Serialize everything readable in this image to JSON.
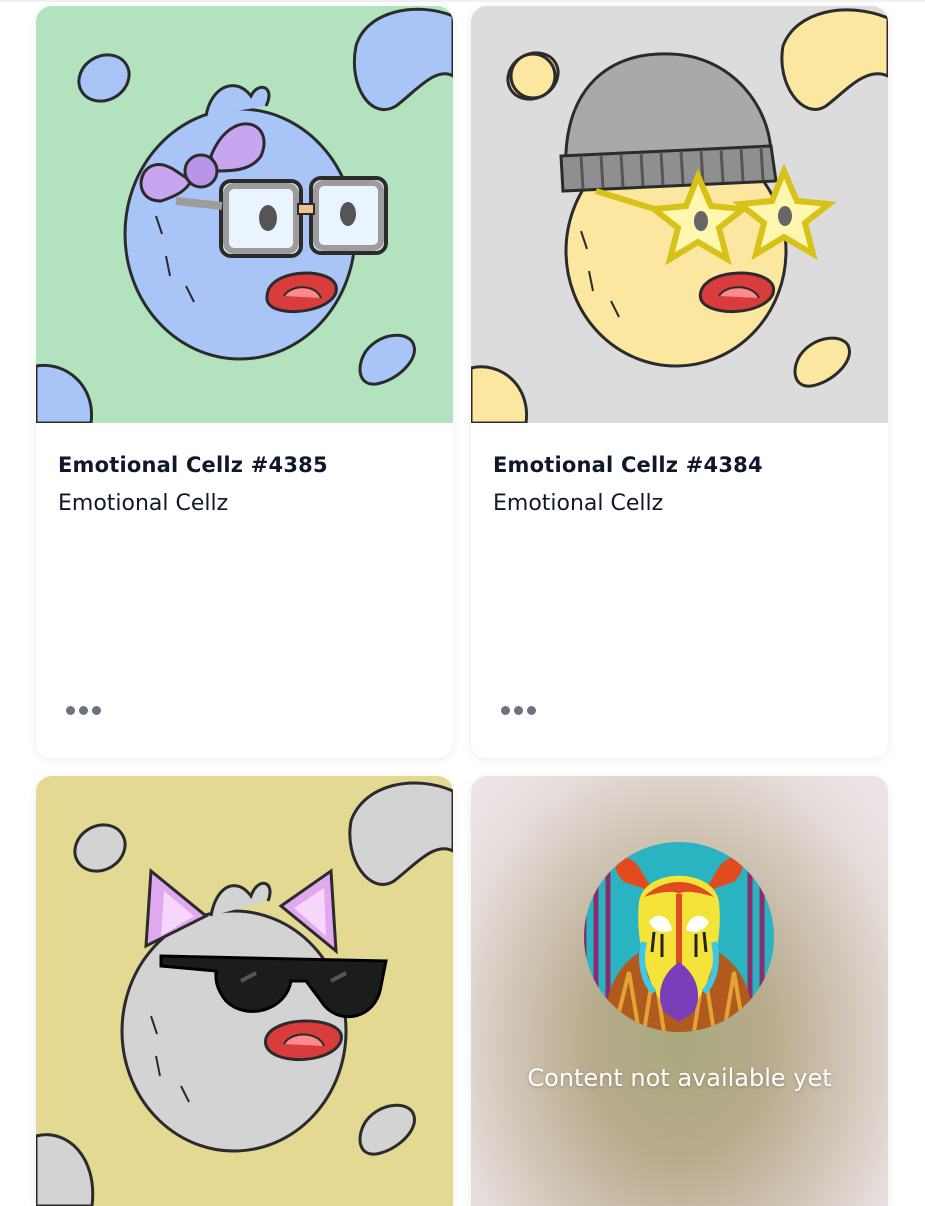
{
  "cards": [
    {
      "title": "Emotional Cellz #4385",
      "collection": "Emotional Cellz",
      "image_bg": "#b3e3be",
      "image_desc": "blue fuzzy cell with pink bow and square glasses",
      "more_icon": "ellipsis-icon"
    },
    {
      "title": "Emotional Cellz #4384",
      "collection": "Emotional Cellz",
      "image_bg": "#dcdcdc",
      "image_desc": "yellow fuzzy cell with grey beanie and star glasses",
      "more_icon": "ellipsis-icon"
    },
    {
      "image_bg": "#e3d993",
      "image_desc": "grey fuzzy cell with cat ears and black sunglasses"
    },
    {
      "status_text": "Content not available yet",
      "image_desc": "colorful masked creature avatar"
    }
  ],
  "colors": {
    "title": "#0f172a",
    "subtitle": "#111827",
    "icon_grey": "#6b7280",
    "blue_cell": "#a9c4f6",
    "yellow_cell": "#fbe7a0",
    "grey_cell": "#d3d3d3"
  }
}
